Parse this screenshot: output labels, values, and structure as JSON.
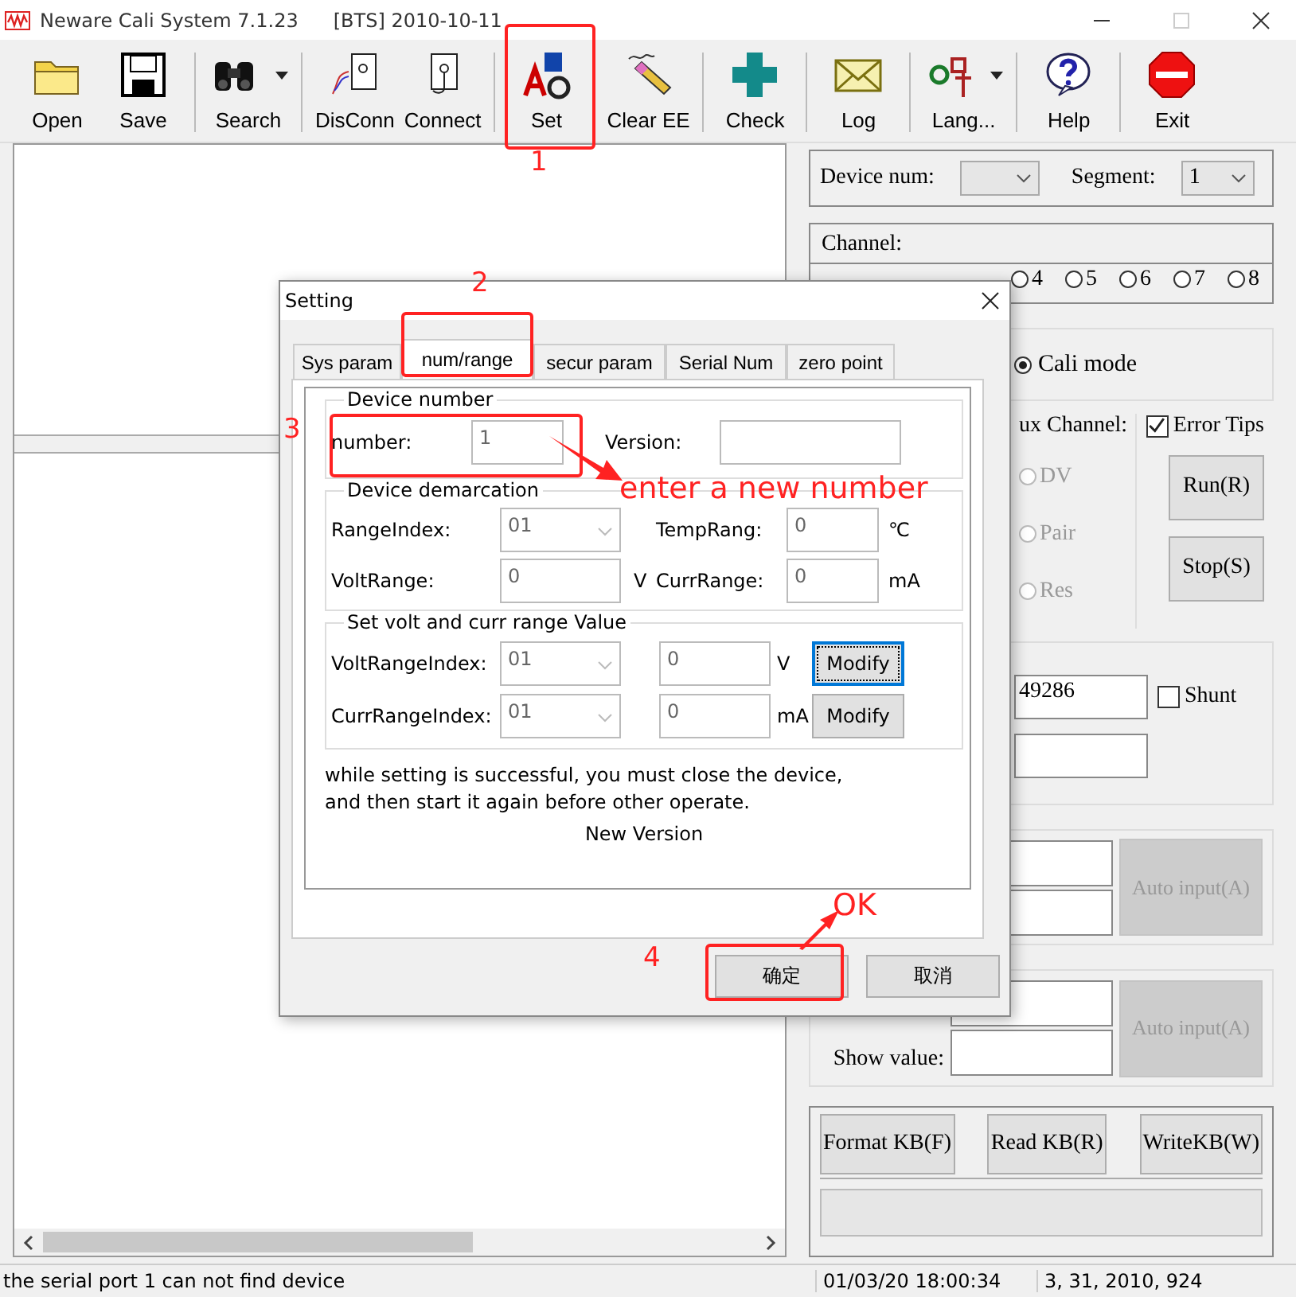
{
  "window": {
    "title": "Neware Cali System 7.1.23",
    "subtitle": "[BTS] 2010-10-11"
  },
  "toolbar": [
    {
      "label": "Open",
      "kind": "open",
      "dropdown": false
    },
    {
      "label": "Save",
      "kind": "save",
      "dropdown": false
    },
    {
      "label": "Search",
      "kind": "search",
      "dropdown": true
    },
    {
      "label": "DisConn",
      "kind": "disconnect",
      "dropdown": false
    },
    {
      "label": "Connect",
      "kind": "connect",
      "dropdown": false
    },
    {
      "label": "Set",
      "kind": "set",
      "dropdown": false
    },
    {
      "label": "Clear EE",
      "kind": "clear",
      "dropdown": false
    },
    {
      "label": "Check",
      "kind": "check",
      "dropdown": false
    },
    {
      "label": "Log",
      "kind": "log",
      "dropdown": false
    },
    {
      "label": "Lang...",
      "kind": "lang",
      "dropdown": true
    },
    {
      "label": "Help",
      "kind": "help",
      "dropdown": false
    },
    {
      "label": "Exit",
      "kind": "exit",
      "dropdown": false
    }
  ],
  "device_panel": {
    "device_num_label": "Device num:",
    "segment_label": "Segment:",
    "segment_value": "1"
  },
  "channel": {
    "label": "Channel:",
    "options": [
      {
        "label": "4",
        "selected": false
      },
      {
        "label": "5",
        "selected": false
      },
      {
        "label": "6",
        "selected": false
      },
      {
        "label": "7",
        "selected": false
      },
      {
        "label": "8",
        "selected": false
      }
    ]
  },
  "mode": {
    "label": "Cali mode",
    "selected": true
  },
  "aux": {
    "label": "ux Channel:",
    "options": [
      {
        "label": "DV",
        "disabled": true
      },
      {
        "label": "Pair",
        "disabled": true
      },
      {
        "label": "Res",
        "disabled": true
      }
    ]
  },
  "error_tips": {
    "label": "Error Tips",
    "checked": true
  },
  "run_button": "Run(R)",
  "stop_button": "Stop(S)",
  "serial_field": {
    "value": "49286"
  },
  "shunt": {
    "label": "Shunt",
    "checked": false
  },
  "auto_input_buttons": [
    {
      "label": "Auto input(A)",
      "disabled": true
    },
    {
      "label": "Auto input(A)",
      "disabled": true
    }
  ],
  "show_value_label": "Show value:",
  "kb_buttons": [
    "Format KB(F)",
    "Read KB(R)",
    "WriteKB(W)"
  ],
  "status_bar": [
    "the serial port 1 can not find device",
    "01/03/20 18:00:34",
    "3, 31, 2010, 924"
  ],
  "dialog": {
    "title": "Setting",
    "tabs": [
      {
        "label": "Sys param",
        "selected": false
      },
      {
        "label": "num/range",
        "selected": true
      },
      {
        "label": "secur param",
        "selected": false
      },
      {
        "label": "Serial Num",
        "selected": false
      },
      {
        "label": "zero point",
        "selected": false
      }
    ],
    "device_number": {
      "title": "Device number",
      "number_label": "number:",
      "number_value": "1",
      "version_label": "Version:"
    },
    "demarcation": {
      "title": "Device demarcation",
      "range_index_label": "RangeIndex:",
      "range_index_value": "01",
      "temp_label": "TempRang:",
      "temp_value": "0",
      "temp_unit": "℃",
      "volt_label": "VoltRange:",
      "volt_value": "0",
      "volt_unit": "V",
      "curr_label": "CurrRange:",
      "curr_value": "0",
      "curr_unit": "mA"
    },
    "range_value": {
      "title": "Set volt and curr range Value",
      "rows": [
        {
          "label": "VoltRangeIndex:",
          "index": "01",
          "value": "0",
          "unit": "V",
          "button": "Modify",
          "focused": true
        },
        {
          "label": "CurrRangeIndex:",
          "index": "01",
          "value": "0",
          "unit": "mA",
          "button": "Modify",
          "focused": false
        }
      ]
    },
    "note": "while setting is successful, you must close the device,\nand then start it again before other operate.",
    "new_version": "New Version",
    "buttons": [
      "确定",
      "取消"
    ]
  },
  "annotations": [
    {
      "kind": "step",
      "text": "1"
    },
    {
      "kind": "step",
      "text": "2"
    },
    {
      "kind": "step",
      "text": "3"
    },
    {
      "kind": "callout",
      "text": "enter a new number"
    },
    {
      "kind": "step",
      "text": "4"
    },
    {
      "kind": "callout",
      "text": "OK"
    }
  ]
}
